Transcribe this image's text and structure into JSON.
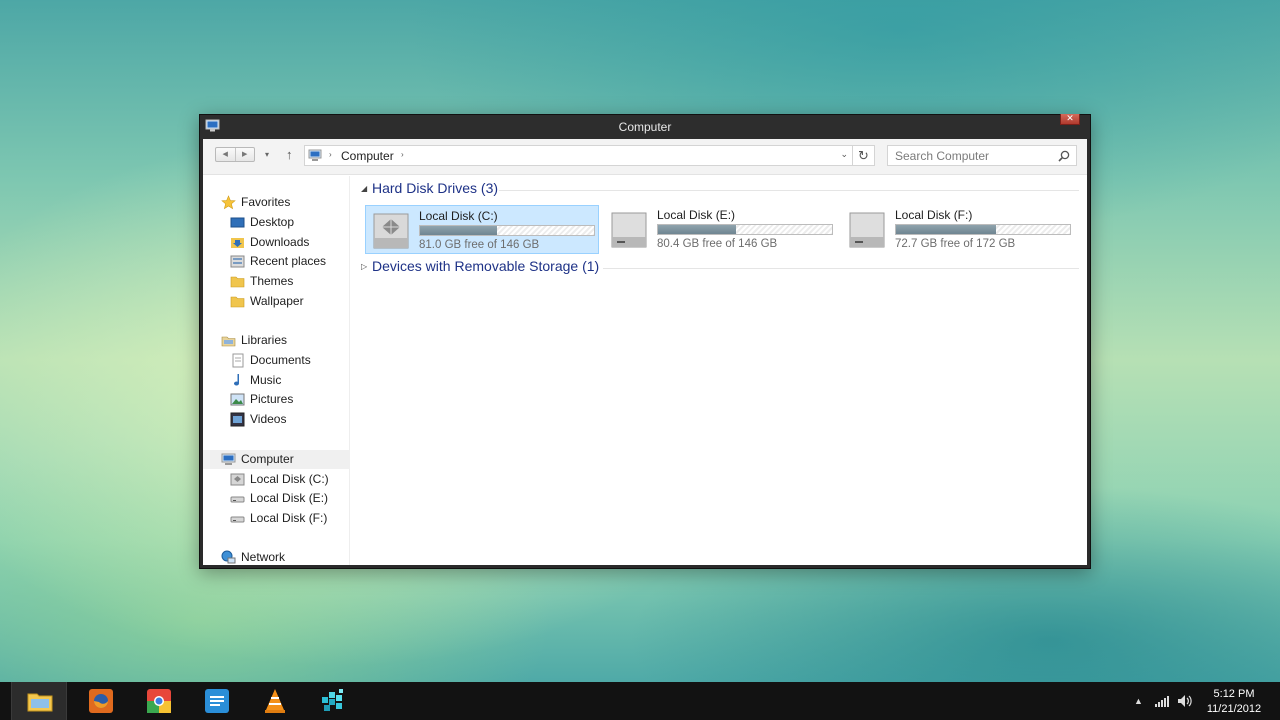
{
  "window": {
    "title": "Computer",
    "close_label": "✕"
  },
  "navbar": {
    "back_label": "◀",
    "forward_label": "▶",
    "recent_label": "▾",
    "up_label": "↑",
    "address": {
      "crumb": "Computer",
      "separator": "›",
      "dropdown": "⌄"
    },
    "refresh_label": "↻",
    "search_placeholder": "Search Computer"
  },
  "sidebar": {
    "favorites": {
      "label": "Favorites",
      "items": [
        {
          "label": "Desktop",
          "icon": "desktop-icon"
        },
        {
          "label": "Downloads",
          "icon": "downloads-icon"
        },
        {
          "label": "Recent places",
          "icon": "recent-places-icon"
        },
        {
          "label": "Themes",
          "icon": "folder-icon"
        },
        {
          "label": "Wallpaper",
          "icon": "folder-icon"
        }
      ]
    },
    "libraries": {
      "label": "Libraries",
      "items": [
        {
          "label": "Documents",
          "icon": "documents-icon"
        },
        {
          "label": "Music",
          "icon": "music-icon"
        },
        {
          "label": "Pictures",
          "icon": "pictures-icon"
        },
        {
          "label": "Videos",
          "icon": "videos-icon"
        }
      ]
    },
    "computer": {
      "label": "Computer",
      "items": [
        {
          "label": "Local Disk (C:)",
          "icon": "system-drive-icon"
        },
        {
          "label": "Local Disk (E:)",
          "icon": "drive-icon"
        },
        {
          "label": "Local Disk (F:)",
          "icon": "drive-icon"
        }
      ]
    },
    "network": {
      "label": "Network"
    }
  },
  "content": {
    "groups": [
      {
        "title": "Hard Disk Drives (3)",
        "expanded": true,
        "toggle": "◢"
      },
      {
        "title": "Devices with Removable Storage (1)",
        "expanded": false,
        "toggle": "▷"
      }
    ],
    "drives": [
      {
        "name": "Local Disk (C:)",
        "free_text": "81.0 GB free of 146 GB",
        "used_fraction": 0.445,
        "selected": true
      },
      {
        "name": "Local Disk (E:)",
        "free_text": "80.4 GB free of 146 GB",
        "used_fraction": 0.449,
        "selected": false
      },
      {
        "name": "Local Disk (F:)",
        "free_text": "72.7 GB free of 172 GB",
        "used_fraction": 0.577,
        "selected": false
      }
    ]
  },
  "taskbar": {
    "apps": [
      "file-explorer",
      "firefox",
      "chrome",
      "notepad",
      "vlc",
      "puzzle-app"
    ],
    "active_app": "file-explorer",
    "tray": {
      "show_hidden": "▲"
    },
    "clock": {
      "time": "5:12 PM",
      "date": "11/21/2012"
    }
  },
  "colors": {
    "selection_bg": "#cce8ff",
    "selection_border": "#99d1ff",
    "group_title": "#1e3287",
    "usage_bar": "#7c919c"
  }
}
